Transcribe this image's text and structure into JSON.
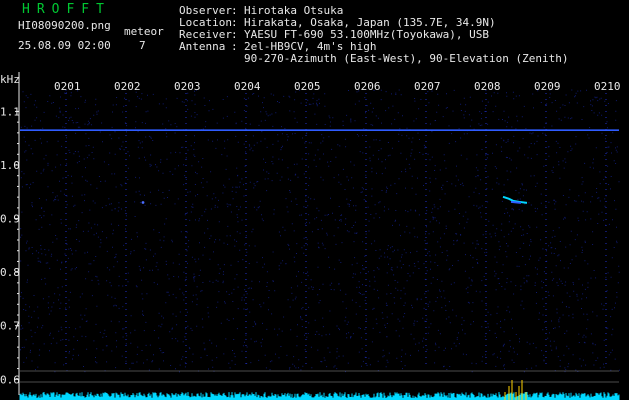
{
  "app_title": "HROFFT",
  "file_name": "HI08090200.png",
  "meteor_label": "meteor",
  "meteor_count": "7",
  "datetime": "25.08.09 02:00",
  "info": [
    {
      "key": "Observer",
      "value": "Hirotaka Otsuka"
    },
    {
      "key": "Location",
      "value": "Hirakata, Osaka, Japan (135.7E, 34.9N)"
    },
    {
      "key": "Receiver",
      "value": "YAESU FT-690 53.100MHz(Toyokawa), USB"
    },
    {
      "key": "Antenna",
      "value": "2el-HB9CV, 4m's high"
    },
    {
      "key": "",
      "value": "90-270-Azimuth (East-West), 90-Elevation (Zenith)"
    }
  ],
  "colors": {
    "background": "#000000",
    "title": "#00c832",
    "text": "#e8e8e8",
    "carrier": "#2f5cff",
    "noise": "#00d8ff",
    "meteor_spike": "#ffd200",
    "grid": "#2030c8"
  },
  "chart_data": {
    "type": "heatmap",
    "ylabel": "kHz",
    "y_ticks": [
      "1.1",
      "1.0",
      "0.9",
      "0.8",
      "0.7",
      "0.6"
    ],
    "ylim": [
      0.58,
      1.14
    ],
    "x_ticks": [
      "0201",
      "0202",
      "0203",
      "0204",
      "0205",
      "0206",
      "0207",
      "0208",
      "0209",
      "0210"
    ],
    "xlim": [
      0,
      10
    ],
    "carrier_khz": 1.065,
    "meteors": [
      {
        "x": 2.25,
        "khz": 0.93
      },
      {
        "x": 8.35,
        "khz": 0.935
      }
    ]
  }
}
